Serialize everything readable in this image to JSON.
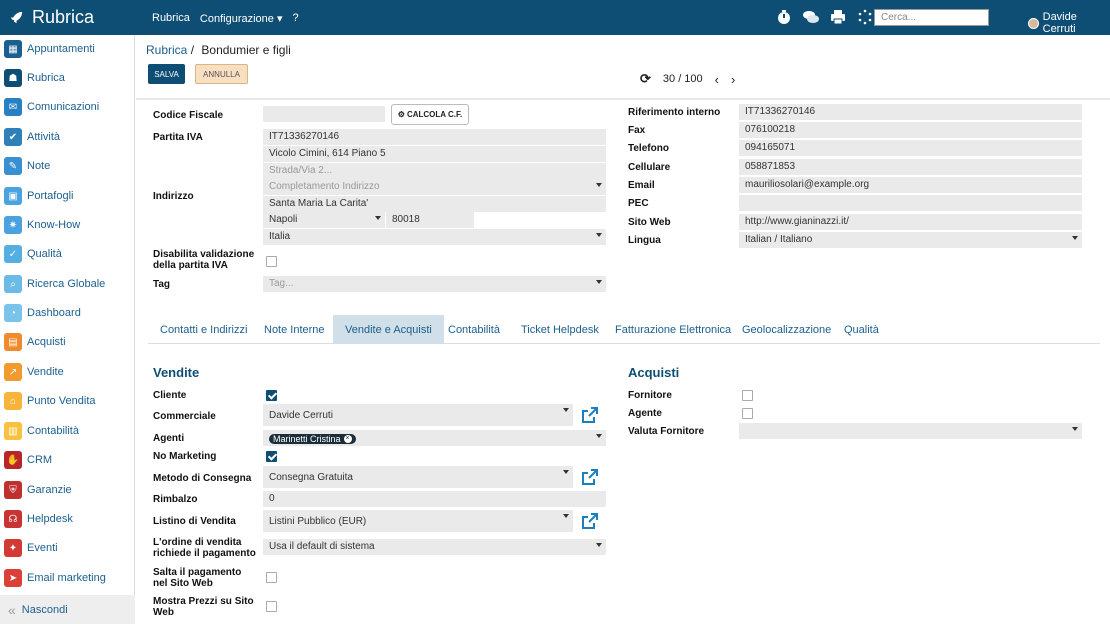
{
  "topbar": {
    "brand": "Rubrica",
    "menu": [
      "Rubrica",
      "Configurazione ▾",
      "?"
    ],
    "search_placeholder": "Cerca...",
    "user": "Davide Cerruti"
  },
  "sidebar": {
    "items": [
      {
        "label": "Appuntamenti",
        "color": "#1b5f8e"
      },
      {
        "label": "Rubrica",
        "color": "#0e4e74"
      },
      {
        "label": "Comunicazioni",
        "color": "#2680c2"
      },
      {
        "label": "Attività",
        "color": "#2f7fb8"
      },
      {
        "label": "Note",
        "color": "#3a8fd0"
      },
      {
        "label": "Portafogli",
        "color": "#4aa3df"
      },
      {
        "label": "Know-How",
        "color": "#4aa3df"
      },
      {
        "label": "Qualità",
        "color": "#55aee0"
      },
      {
        "label": "Ricerca Globale",
        "color": "#6bbbe6"
      },
      {
        "label": "Dashboard",
        "color": "#7ac3ea"
      },
      {
        "label": "Acquisti",
        "color": "#f08a2c"
      },
      {
        "label": "Vendite",
        "color": "#f39a2f"
      },
      {
        "label": "Punto Vendita",
        "color": "#f6b43a"
      },
      {
        "label": "Contabilità",
        "color": "#f7c23f"
      },
      {
        "label": "CRM",
        "color": "#b8252a"
      },
      {
        "label": "Garanzie",
        "color": "#c0302f"
      },
      {
        "label": "Helpdesk",
        "color": "#c83333"
      },
      {
        "label": "Eventi",
        "color": "#d23a36"
      },
      {
        "label": "Email marketing",
        "color": "#da3f38"
      }
    ],
    "footer": "Nascondi"
  },
  "header": {
    "breadcrumb_parent": "Rubrica",
    "breadcrumb_sep": "/",
    "breadcrumb_current": "Bondumier e figli",
    "save": "SALVA",
    "cancel": "ANNULLA",
    "pager": "30 / 100"
  },
  "left": {
    "codice_fiscale_label": "Codice Fiscale",
    "codice_fiscale": "",
    "calc_button": "CALCOLA C.F.",
    "piva_label": "Partita IVA",
    "piva": "IT71336270146",
    "indirizzo_label": "Indirizzo",
    "street": "Vicolo Cimini, 614 Piano 5",
    "street2_placeholder": "Strada/Via 2...",
    "completamento_placeholder": "Completamento Indirizzo",
    "locality": "Santa Maria La Carita'",
    "city": "Napoli",
    "zip": "80018",
    "country": "Italia",
    "disable_validation_label": "Disabilita validazione della partita IVA",
    "tag_label": "Tag",
    "tag_placeholder": "Tag..."
  },
  "right": {
    "rif_label": "Riferimento interno",
    "rif": "IT71336270146",
    "fax_label": "Fax",
    "fax": "076100218",
    "tel_label": "Telefono",
    "tel": "094165071",
    "cell_label": "Cellulare",
    "cell": "058871853",
    "email_label": "Email",
    "email": "mauriliosolari@example.org",
    "pec_label": "PEC",
    "pec": "",
    "web_label": "Sito Web",
    "web": "http://www.gianinazzi.it/",
    "lang_label": "Lingua",
    "lang": "Italian / Italiano"
  },
  "tabs": [
    "Contatti e Indirizzi",
    "Note Interne",
    "Vendite e Acquisti",
    "Contabilità",
    "Ticket Helpdesk",
    "Fatturazione Elettronica",
    "Geolocalizzazione",
    "Qualità"
  ],
  "vendite": {
    "title": "Vendite",
    "cliente_label": "Cliente",
    "cliente": true,
    "commerciale_label": "Commerciale",
    "commerciale": "Davide Cerruti",
    "agenti_label": "Agenti",
    "agente_tag": "Marinetti Cristina",
    "no_marketing_label": "No Marketing",
    "no_marketing": true,
    "metodo_label": "Metodo di Consegna",
    "metodo": "Consegna Gratuita",
    "rimbalzo_label": "Rimbalzo",
    "rimbalzo": "0",
    "listino_label": "Listino di Vendita",
    "listino": "Listini Pubblico (EUR)",
    "ordine_label": "L'ordine di vendita richiede il pagamento",
    "ordine": "Usa il default di sistema",
    "salta_label": "Salta il pagamento nel Sito Web",
    "prezzi_label": "Mostra Prezzi su Sito Web"
  },
  "acquisti": {
    "title": "Acquisti",
    "fornitore_label": "Fornitore",
    "agente_label": "Agente",
    "valuta_label": "Valuta Fornitore",
    "valuta": ""
  }
}
